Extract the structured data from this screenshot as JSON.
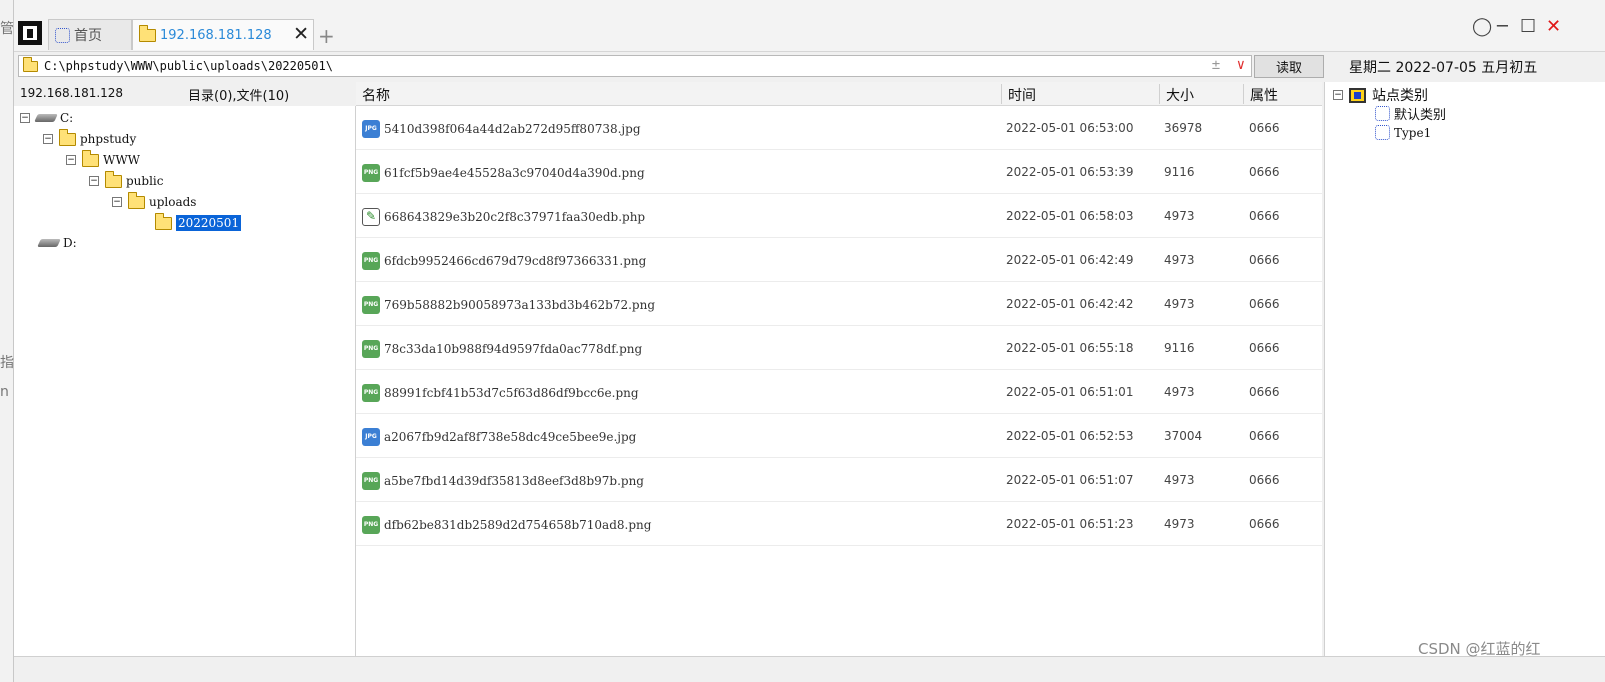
{
  "tabs": {
    "home_label": "首页",
    "active_label": "192.168.181.128",
    "add_symbol": "+",
    "close_symbol": "✕"
  },
  "window_controls": {
    "circle": "◯",
    "minimize": "─",
    "maximize": "☐",
    "close": "✕"
  },
  "address_bar": {
    "path": "C:\\phpstudy\\WWW\\public\\uploads\\20220501\\",
    "pm_symbol": "±",
    "dropdown_symbol": "∨",
    "read_button": "读取"
  },
  "date_display": "星期二  2022-07-05  五月初五",
  "left_panel": {
    "host_ip": "192.168.181.128",
    "summary": "目录(0),文件(10)",
    "tree": [
      {
        "label": "C:",
        "type": "drive",
        "toggle": "⊟"
      },
      {
        "label": "phpstudy",
        "type": "folder",
        "toggle": "⊟"
      },
      {
        "label": "WWW",
        "type": "folder",
        "toggle": "⊟"
      },
      {
        "label": "public",
        "type": "folder",
        "toggle": "⊟"
      },
      {
        "label": "uploads",
        "type": "folder",
        "toggle": "⊟"
      },
      {
        "label": "20220501",
        "type": "folder",
        "selected": true
      },
      {
        "label": "D:",
        "type": "drive"
      }
    ]
  },
  "file_list": {
    "columns": {
      "name": "名称",
      "time": "时间",
      "size": "大小",
      "attr": "属性"
    },
    "files": [
      {
        "name": "5410d398f064a44d2ab272d95ff80738.jpg",
        "icon": "jpg",
        "time": "2022-05-01 06:53:00",
        "size": "36978",
        "attr": "0666"
      },
      {
        "name": "61fcf5b9ae4e45528a3c97040d4a390d.png",
        "icon": "png",
        "time": "2022-05-01 06:53:39",
        "size": "9116",
        "attr": "0666"
      },
      {
        "name": "668643829e3b20c2f8c37971faa30edb.php",
        "icon": "php",
        "time": "2022-05-01 06:58:03",
        "size": "4973",
        "attr": "0666"
      },
      {
        "name": "6fdcb9952466cd679d79cd8f97366331.png",
        "icon": "png",
        "time": "2022-05-01 06:42:49",
        "size": "4973",
        "attr": "0666"
      },
      {
        "name": "769b58882b90058973a133bd3b462b72.png",
        "icon": "png",
        "time": "2022-05-01 06:42:42",
        "size": "4973",
        "attr": "0666"
      },
      {
        "name": "78c33da10b988f94d9597fda0ac778df.png",
        "icon": "png",
        "time": "2022-05-01 06:55:18",
        "size": "9116",
        "attr": "0666"
      },
      {
        "name": "88991fcbf41b53d7c5f63d86df9bcc6e.png",
        "icon": "png",
        "time": "2022-05-01 06:51:01",
        "size": "4973",
        "attr": "0666"
      },
      {
        "name": "a2067fb9d2af8f738e58dc49ce5bee9e.jpg",
        "icon": "jpg",
        "time": "2022-05-01 06:52:53",
        "size": "37004",
        "attr": "0666"
      },
      {
        "name": "a5be7fbd14d39df35813d8eef3d8b97b.png",
        "icon": "png",
        "time": "2022-05-01 06:51:07",
        "size": "4973",
        "attr": "0666"
      },
      {
        "name": "dfb62be831db2589d2d754658b710ad8.png",
        "icon": "png",
        "time": "2022-05-01 06:51:23",
        "size": "4973",
        "attr": "0666"
      }
    ]
  },
  "right_panel": {
    "root": {
      "label": "站点类别",
      "toggle": "⊟"
    },
    "children": [
      "默认类别",
      "Type1"
    ]
  },
  "watermark": "CSDN @红蓝的红"
}
